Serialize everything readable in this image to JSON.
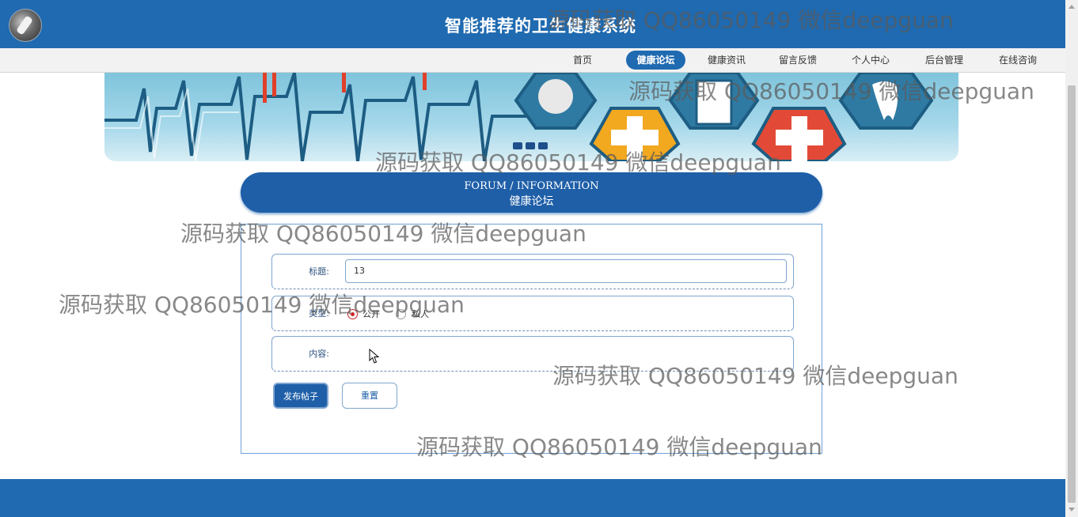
{
  "header": {
    "title": "智能推荐的卫生健康系统"
  },
  "nav": {
    "items": [
      {
        "label": "首页",
        "active": false
      },
      {
        "label": "健康论坛",
        "active": true
      },
      {
        "label": "健康资讯",
        "active": false
      },
      {
        "label": "留言反馈",
        "active": false
      },
      {
        "label": "个人中心",
        "active": false
      },
      {
        "label": "后台管理",
        "active": false
      },
      {
        "label": "在线咨询",
        "active": false
      }
    ]
  },
  "section": {
    "title_en": "FORUM / INFORMATION",
    "title_cn": "健康论坛"
  },
  "form": {
    "title_label": "标题:",
    "title_value": "13",
    "type_label": "类型:",
    "type_options": [
      "公开",
      "私人"
    ],
    "type_selected": "公开",
    "content_label": "内容:",
    "submit_label": "发布帖子",
    "reset_label": "重置"
  },
  "watermark": {
    "text": "源码获取 QQ86050149 微信deepguan"
  },
  "colors": {
    "primary": "#1f6ab0",
    "accent": "#1f5fa8",
    "radio_selected": "#c62828"
  }
}
